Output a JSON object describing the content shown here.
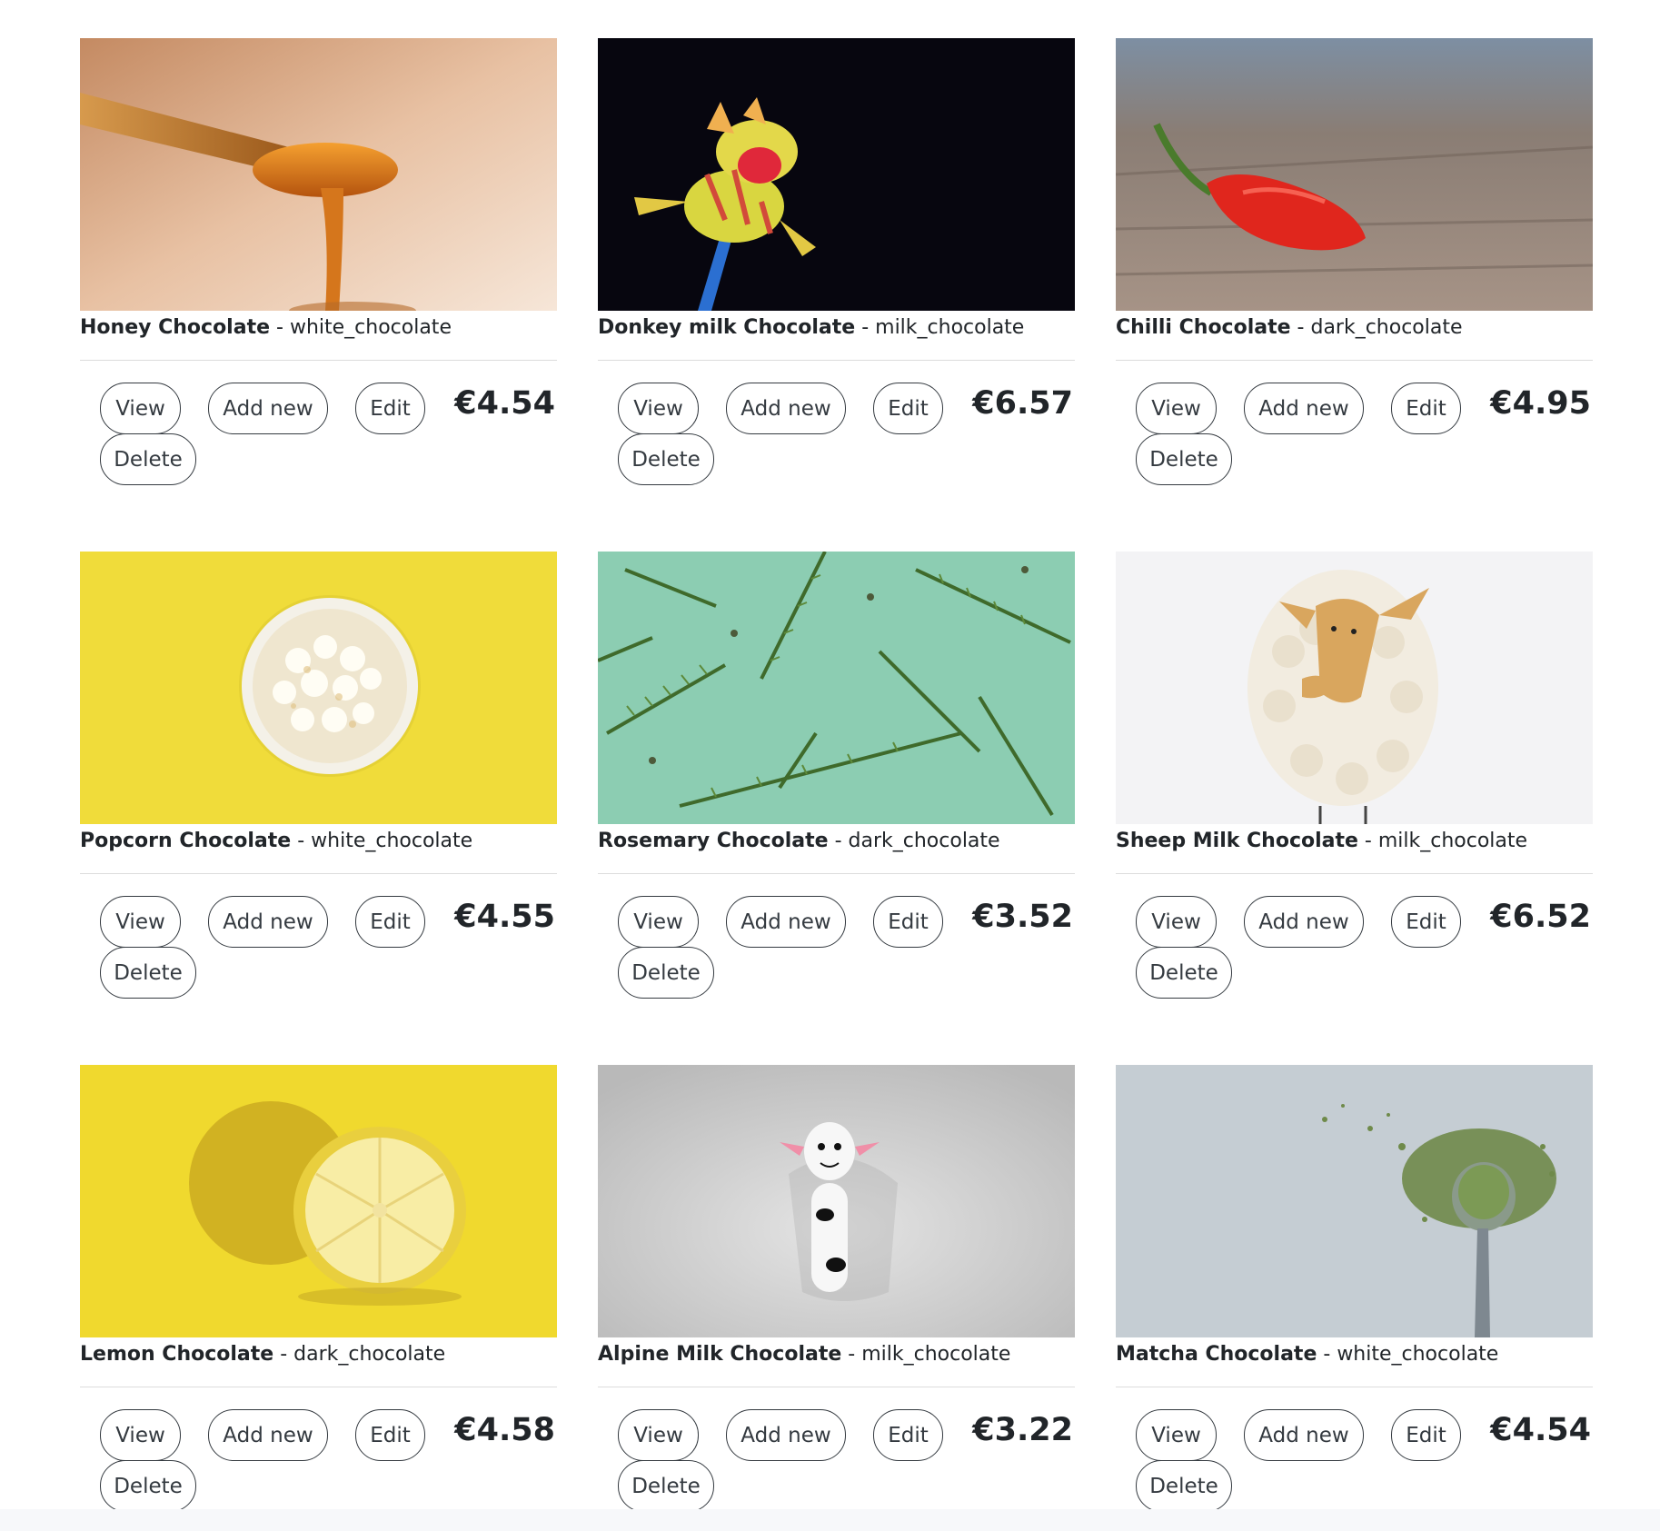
{
  "products": [
    {
      "name": "Honey Chocolate",
      "category": "white_chocolate",
      "price": "€4.54",
      "image": "honey-dripping-spoon-photo"
    },
    {
      "name": "Donkey milk Chocolate",
      "category": "milk_chocolate",
      "price": "€6.57",
      "image": "toy-donkey-pencil-topper-photo"
    },
    {
      "name": "Chilli Chocolate",
      "category": "dark_chocolate",
      "price": "€4.95",
      "image": "red-chilli-pepper-photo"
    },
    {
      "name": "Popcorn Chocolate",
      "category": "white_chocolate",
      "price": "€4.55",
      "image": "popcorn-bowl-photo"
    },
    {
      "name": "Rosemary Chocolate",
      "category": "dark_chocolate",
      "price": "€3.52",
      "image": "rosemary-sprigs-photo"
    },
    {
      "name": "Sheep Milk Chocolate",
      "category": "milk_chocolate",
      "price": "€6.52",
      "image": "wool-sheep-figure-photo"
    },
    {
      "name": "Lemon Chocolate",
      "category": "dark_chocolate",
      "price": "€4.58",
      "image": "lemon-halves-photo"
    },
    {
      "name": "Alpine Milk Chocolate",
      "category": "milk_chocolate",
      "price": "€3.22",
      "image": "toy-cow-figure-photo"
    },
    {
      "name": "Matcha Chocolate",
      "category": "white_chocolate",
      "price": "€4.54",
      "image": "matcha-powder-spoon-photo"
    }
  ],
  "labels": {
    "separator": " - ",
    "view": "View",
    "add_new": "Add new",
    "edit": "Edit",
    "delete": "Delete"
  }
}
